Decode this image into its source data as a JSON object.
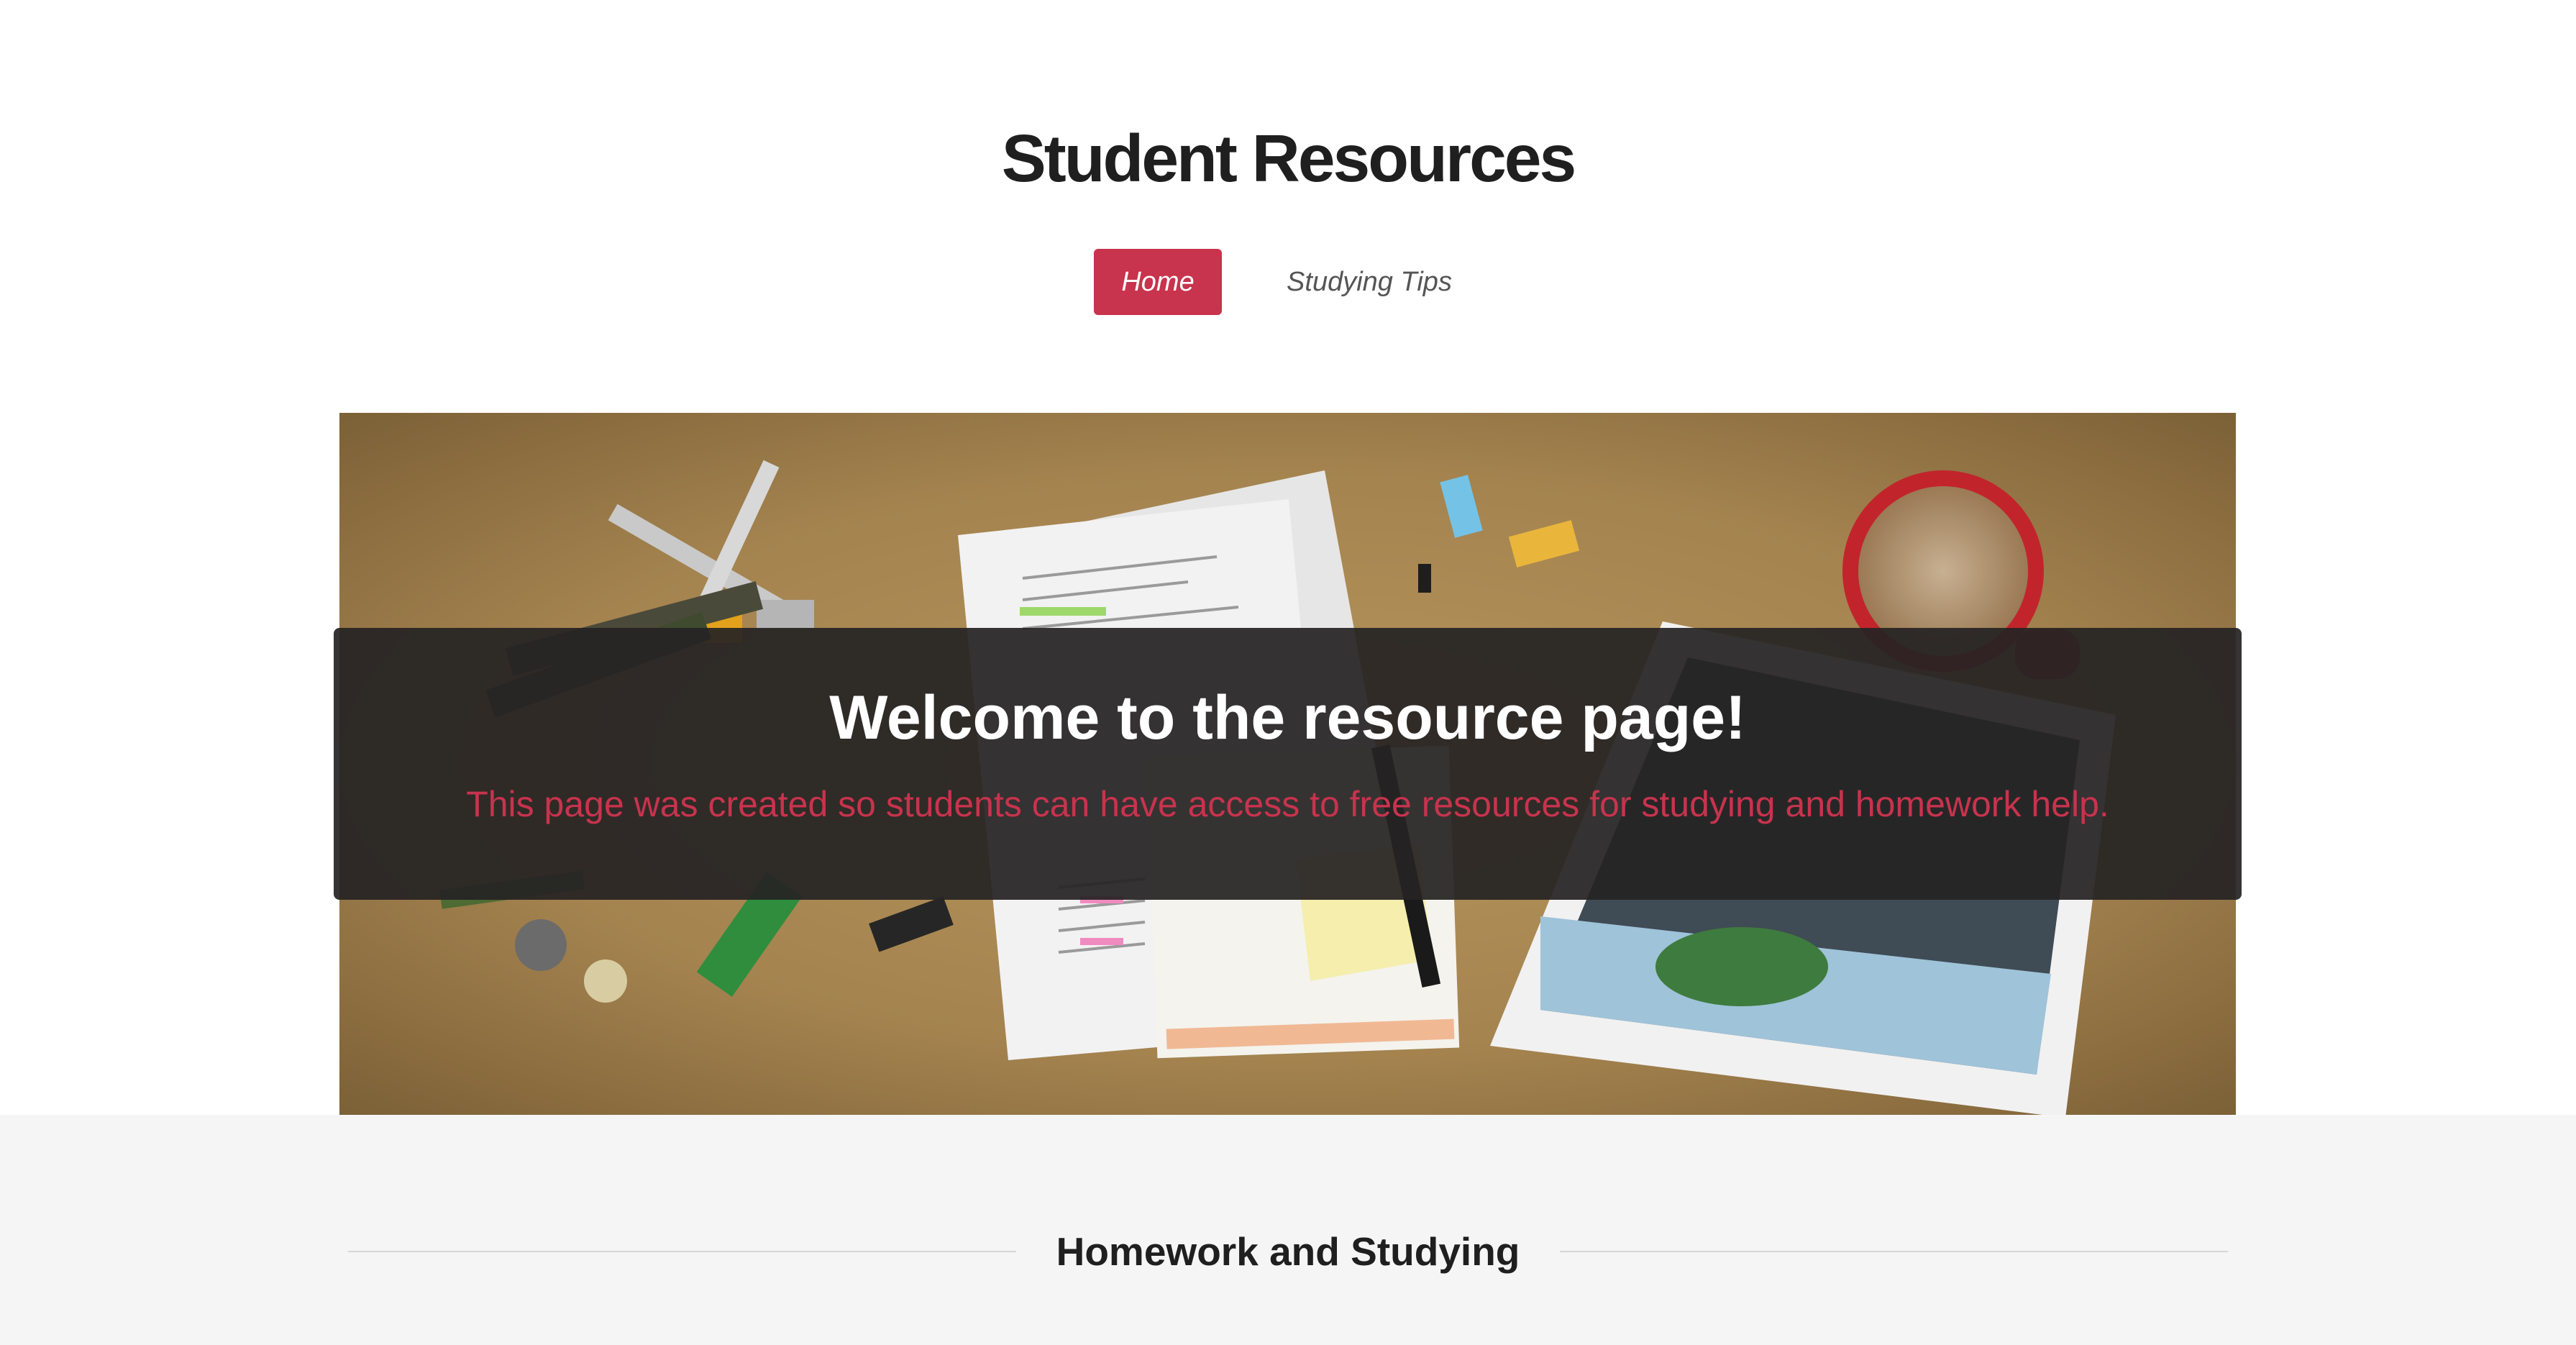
{
  "site": {
    "title": "Student Resources"
  },
  "nav": {
    "items": [
      {
        "label": "Home",
        "active": true
      },
      {
        "label": "Studying Tips",
        "active": false
      }
    ]
  },
  "hero": {
    "heading": "Welcome to the resource page!",
    "subheading": "This page was created so students can have access to free resources for studying and homework help.",
    "image_description_icon": "desk-with-papers-tablet-coffee-image"
  },
  "section": {
    "title": "Homework and Studying"
  },
  "colors": {
    "accent": "#c8334d",
    "title_text": "#1f1f1f",
    "section_bg": "#f5f5f5",
    "overlay_bg": "#262423"
  }
}
